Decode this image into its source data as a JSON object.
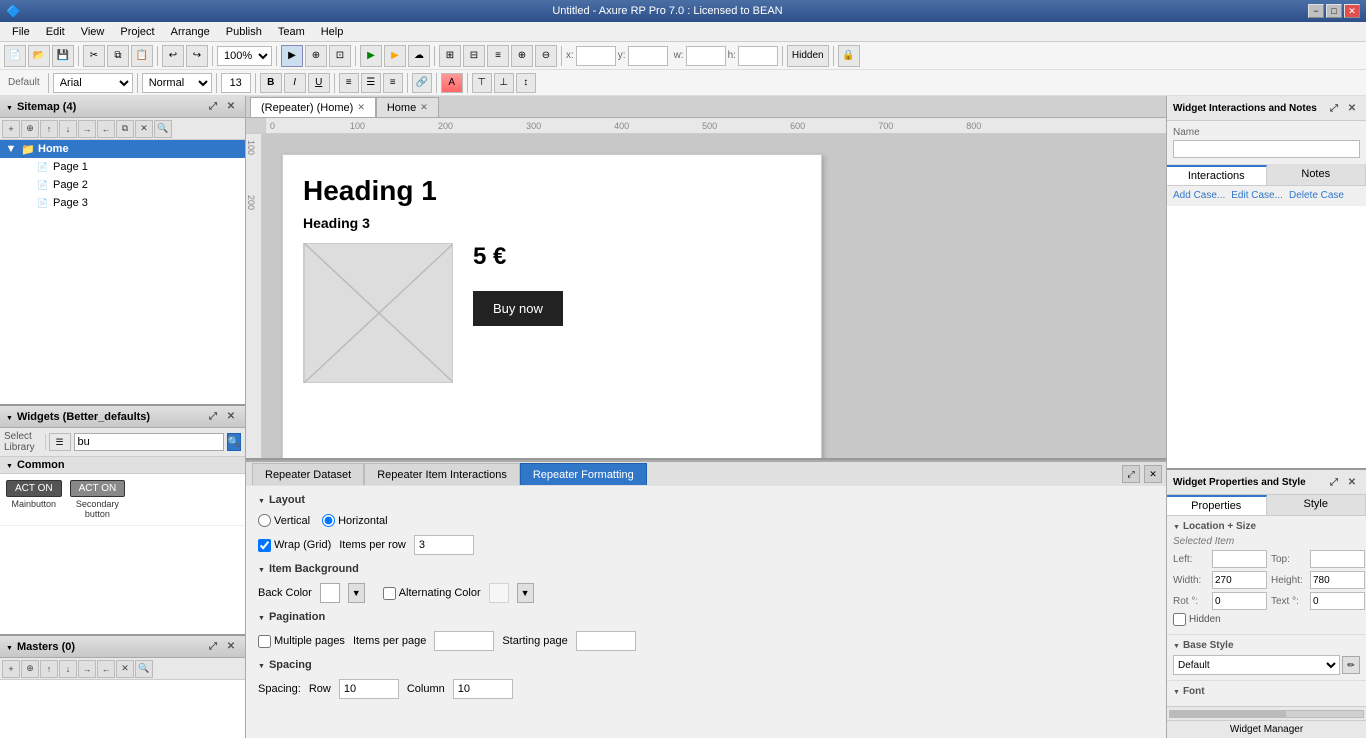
{
  "titleBar": {
    "title": "Untitled - Axure RP Pro 7.0 : Licensed to BEAN",
    "minimize": "−",
    "maximize": "□",
    "close": "✕"
  },
  "menuBar": {
    "items": [
      "File",
      "Edit",
      "View",
      "Project",
      "Arrange",
      "Publish",
      "Team",
      "Help"
    ]
  },
  "toolbar": {
    "zoom": "100%",
    "fontFamily": "Arial",
    "fontStyle": "Normal",
    "fontSize": "13"
  },
  "sitemap": {
    "title": "Sitemap (4)",
    "home": "Home",
    "pages": [
      "Page 1",
      "Page 2",
      "Page 3"
    ]
  },
  "widgets": {
    "title": "Widgets (Better_defaults)",
    "selectLibrary": "Select Library",
    "searchPlaceholder": "bu",
    "sectionLabel": "Common",
    "items": [
      {
        "label": "Mainbutton",
        "btnText": "ACT ON"
      },
      {
        "label": "Secondarybutton",
        "btnText": "ACT ON"
      }
    ]
  },
  "masters": {
    "title": "Masters (0)"
  },
  "canvasTabs": {
    "repeaterTab": "(Repeater) (Home)",
    "homeTab": "Home"
  },
  "design": {
    "heading1": "Heading 1",
    "heading3": "Heading 3",
    "price": "5 €",
    "buyButton": "Buy now"
  },
  "bottomTabs": {
    "dataset": "Repeater Dataset",
    "itemInteractions": "Repeater Item Interactions",
    "formatting": "Repeater Formatting"
  },
  "layout": {
    "sectionTitle": "Layout",
    "vertical": "Vertical",
    "horizontal": "Horizontal",
    "wrapGrid": "Wrap (Grid)",
    "itemsPerRow": "Items per row",
    "itemsPerRowValue": "3"
  },
  "itemBackground": {
    "sectionTitle": "Item Background",
    "backColor": "Back Color",
    "alternatingColor": "Alternating Color"
  },
  "pagination": {
    "sectionTitle": "Pagination",
    "multiplePages": "Multiple pages",
    "itemsPerPage": "Items per page",
    "startingPage": "Starting page"
  },
  "spacing": {
    "sectionTitle": "Spacing",
    "spacingLabel": "Spacing:",
    "row": "Row",
    "rowValue": "10",
    "column": "Column",
    "columnValue": "10"
  },
  "interactions": {
    "panelTitle": "Widget Interactions and Notes",
    "nameLabel": "Name",
    "interactionsTab": "Interactions",
    "notesTab": "Notes",
    "addCase": "Add Case...",
    "editCase": "Edit Case...",
    "deleteCase": "Delete Case"
  },
  "properties": {
    "panelTitle": "Widget Properties and Style",
    "propertiesTab": "Properties",
    "styleTab": "Style",
    "locationSize": "Location + Size",
    "selectedItem": "Selected Item",
    "leftLabel": "Left:",
    "topLabel": "Top:",
    "widthLabel": "Width:",
    "heightLabel": "Height:",
    "widthValue": "270",
    "heightValue": "780",
    "rotLabel": "Rot °:",
    "rotValue": "0",
    "textLabel": "Text °:",
    "textValue": "0",
    "hidden": "Hidden",
    "baseStyle": "Base Style",
    "defaultStyle": "Default",
    "font": "Font"
  }
}
